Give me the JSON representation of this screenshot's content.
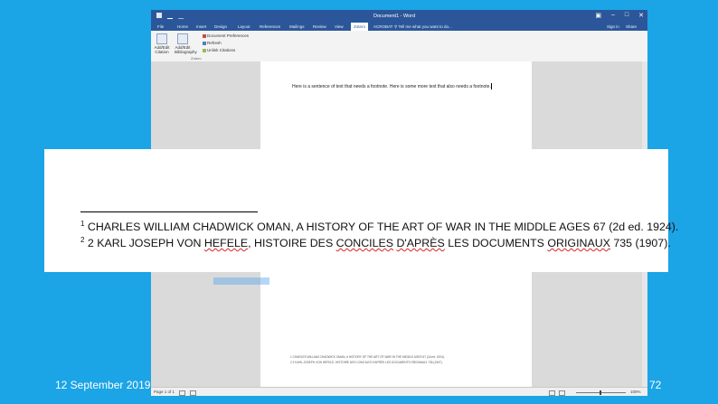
{
  "word": {
    "title": "Document1 - Word",
    "tabs": [
      "File",
      "Home",
      "Insert",
      "Design",
      "Layout",
      "References",
      "Mailings",
      "Review",
      "View",
      "Zotero",
      "ACROBAT"
    ],
    "active_tab": "Zotero",
    "tell_me": "Tell me what you want to do...",
    "sign_in": "Sign in",
    "share": "Share",
    "ribbon": {
      "btn1_label": "Add/Edit Citation",
      "btn2_label": "Add/Edit Bibliography",
      "doc_prefs": "Document Preferences",
      "refresh": "Refresh",
      "unlink": "Unlink Citations",
      "group": "Zotero"
    },
    "body_text": "Here is a sentence of text that needs a footnote. Here is some more text that also needs a footnote.",
    "page_footnotes": [
      "1 CHARLES WILLIAM CHADWICK OMAN, A HISTORY OF THE ART OF WAR IN THE MIDDLE AGES 67 (2d ed. 1924).",
      "2 2 KARL JOSEPH VON HEFELE, HISTOIRE DES CONCILES D'APRÈS LES DOCUMENTS ORIGINAUX 735 (1907)."
    ],
    "status": {
      "page": "Page 1 of 1",
      "zoom": "100%"
    }
  },
  "overlay": {
    "fn1": {
      "num": "1",
      "text": "CHARLES WILLIAM CHADWICK OMAN, A HISTORY OF THE ART OF WAR IN THE MIDDLE AGES 67 (2d ed. 1924)."
    },
    "fn2": {
      "num": "2",
      "pre": "2 KARL JOSEPH VON ",
      "sq1": "HEFELE",
      "mid1": ", HISTOIRE DES ",
      "sq2": "CONCILES",
      "mid2": " ",
      "sq3": "D'APRÈS",
      "mid3": " LES DOCUMENTS ",
      "sq4": "ORIGINAUX",
      "post": " 735 (1907)."
    }
  },
  "slide": {
    "date": "12 September 2019",
    "number": "72"
  }
}
